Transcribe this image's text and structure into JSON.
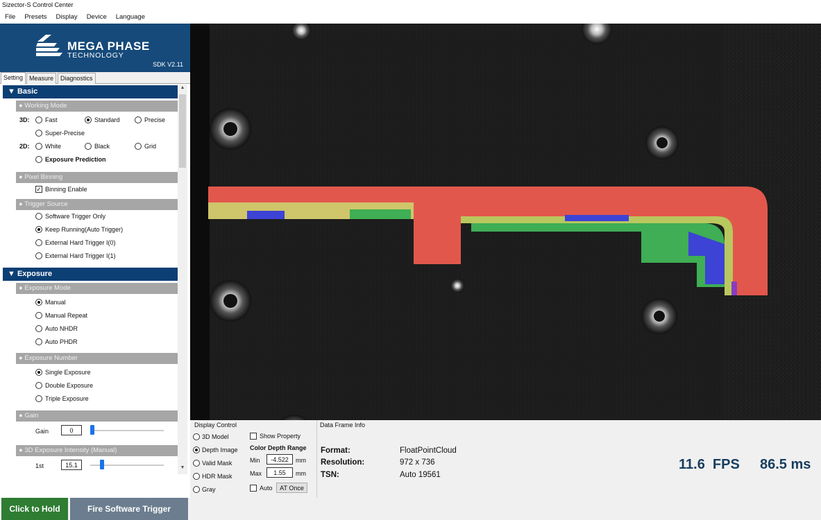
{
  "window": {
    "title": "Sizector-S Control Center"
  },
  "menu": [
    "File",
    "Presets",
    "Display",
    "Device",
    "Language"
  ],
  "logo": {
    "brand": "MEGA PHASE",
    "sub": "TECHNOLOGY",
    "sdk": "SDK V2.11"
  },
  "tabs": [
    "Setting",
    "Measure",
    "Diagnostics"
  ],
  "basic": {
    "title": "▼ Basic",
    "working_mode": {
      "title": "● Working Mode",
      "label_3d": "3D:",
      "label_2d": "2D:",
      "options_3d": [
        "Fast",
        "Standard",
        "Precise",
        "Super-Precise"
      ],
      "options_2d": [
        "White",
        "Black",
        "Grid"
      ],
      "selected_3d": "Standard",
      "exposure_prediction": "Exposure Prediction"
    },
    "pixel_binning": {
      "title": "● Pixel Binning",
      "label": "Binning Enable",
      "checked": true
    },
    "trigger_source": {
      "title": "● Trigger Source",
      "options": [
        "Software Trigger Only",
        "Keep Running(Auto Trigger)",
        "External Hard Trigger I(0)",
        "External Hard Trigger I(1)"
      ],
      "selected": "Keep Running(Auto Trigger)"
    }
  },
  "exposure": {
    "title": "▼ Exposure",
    "mode": {
      "title": "● Exposure Mode",
      "options": [
        "Manual",
        "Manual Repeat",
        "Auto NHDR",
        "Auto PHDR"
      ],
      "selected": "Manual"
    },
    "number": {
      "title": "● Exposure Number",
      "options": [
        "Single Exposure",
        "Double Exposure",
        "Triple Exposure"
      ],
      "selected": "Single Exposure"
    },
    "gain": {
      "title": "● Gain",
      "label": "Gain",
      "value": "0"
    },
    "intensity": {
      "title": "● 3D Exposure Intensity (Manual)",
      "label": "1st",
      "value": "15.1"
    }
  },
  "buttons": {
    "hold": "Click to Hold",
    "fire": "Fire Software Trigger"
  },
  "display_control": {
    "title": "Display Control",
    "options": [
      "3D Model",
      "Depth Image",
      "Valid Mask",
      "HDR Mask",
      "Gray"
    ],
    "selected": "Depth Image",
    "show_property": "Show Property",
    "color_depth_range": "Color Depth Range",
    "min_label": "Min",
    "min_value": "-4.522",
    "max_label": "Max",
    "max_value": "1.55",
    "unit": "mm",
    "auto_label": "Auto",
    "at_once": "AT Once"
  },
  "frame_info": {
    "title": "Data Frame Info",
    "format_label": "Format:",
    "format_value": "FloatPointCloud",
    "resolution_label": "Resolution:",
    "resolution_value": "972 x 736",
    "tsn_label": "TSN:",
    "tsn_value": "Auto 19561",
    "fps": "11.6  FPS",
    "ms": "86.5 ms"
  }
}
